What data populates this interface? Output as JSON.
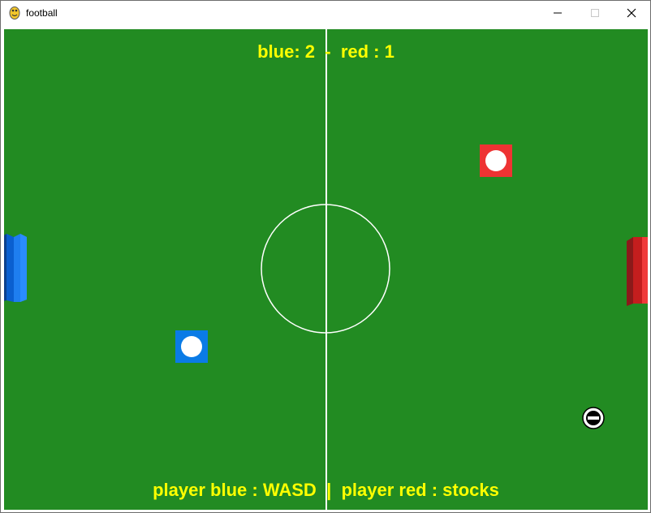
{
  "window": {
    "title": "football",
    "app_icon": "pygame-snake-icon",
    "controls": [
      "minimize-icon",
      "maximize-icon",
      "close-icon"
    ]
  },
  "game": {
    "score": {
      "blue_label": "blue:",
      "blue_value": "2",
      "separator": "-",
      "red_label": "red :",
      "red_value": "1"
    },
    "controls_text": {
      "blue": "player blue : WASD",
      "divider": "|",
      "red": "player red : stocks"
    },
    "colors": {
      "field": "#228b22",
      "lines": "#ffffff",
      "text": "#ffff00",
      "blue_team": "#0a7be6",
      "red_team": "#ee3333"
    }
  }
}
